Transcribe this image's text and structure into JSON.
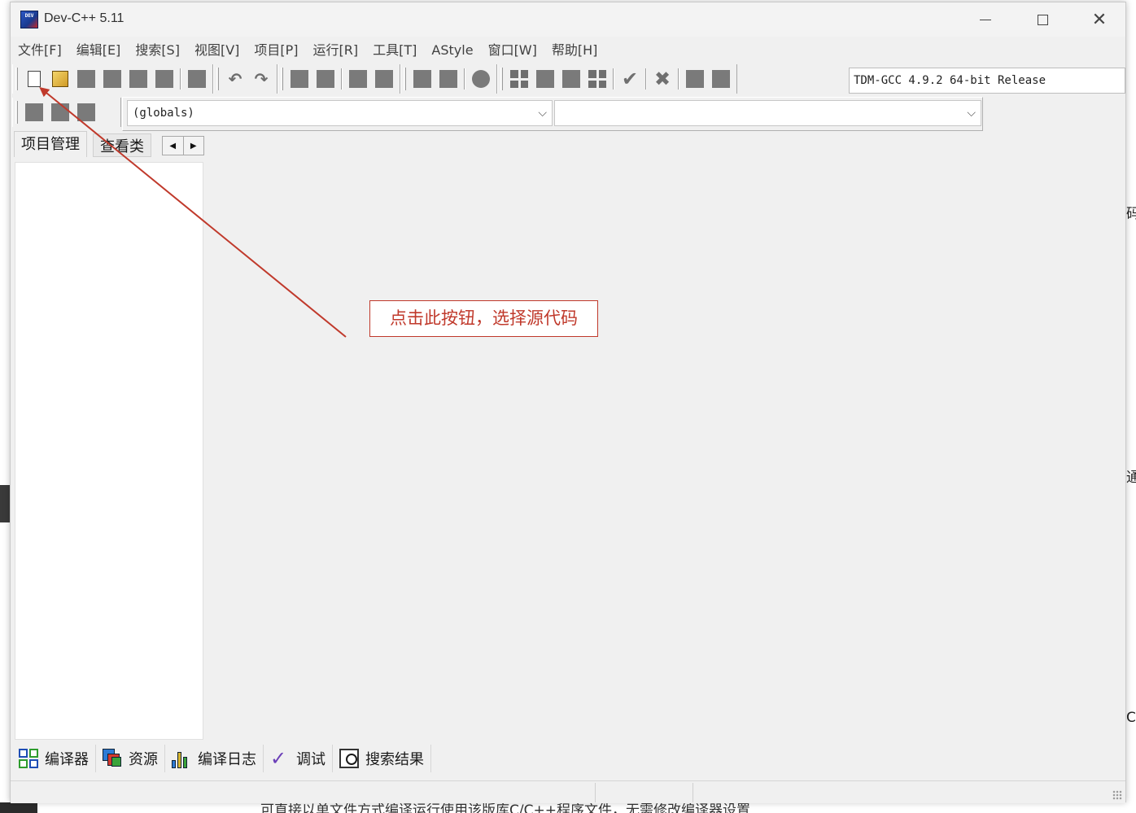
{
  "window": {
    "title": "Dev-C++ 5.11",
    "icon_label": "DEV"
  },
  "menu": [
    {
      "label": "文件[F]"
    },
    {
      "label": "编辑[E]"
    },
    {
      "label": "搜索[S]"
    },
    {
      "label": "视图[V]"
    },
    {
      "label": "项目[P]"
    },
    {
      "label": "运行[R]"
    },
    {
      "label": "工具[T]"
    },
    {
      "label": "AStyle"
    },
    {
      "label": "窗口[W]"
    },
    {
      "label": "帮助[H]"
    }
  ],
  "toolbar": {
    "compiler_select": "TDM-GCC 4.9.2 64-bit Release"
  },
  "navigation": {
    "scope_select": "(globals)",
    "member_select": ""
  },
  "left_panel": {
    "tabs": [
      {
        "label": "项目管理"
      },
      {
        "label": "查看类"
      }
    ]
  },
  "bottom_tabs": [
    {
      "label": "编译器",
      "icon": "compiler-icon"
    },
    {
      "label": "资源",
      "icon": "resources-icon"
    },
    {
      "label": "编译日志",
      "icon": "compile-log-icon"
    },
    {
      "label": "调试",
      "icon": "debug-icon"
    },
    {
      "label": "搜索结果",
      "icon": "search-results-icon"
    }
  ],
  "annotation": {
    "text": "点击此按钮，选择源代码",
    "color": "#c0392b"
  },
  "background": {
    "bottom_text": "可直接以单文件方式编译运行使用该版库C/C++程序文件，无需修改编译器设置",
    "right_edge_chars": [
      "码",
      "通",
      "C"
    ]
  },
  "colors": {
    "window_bg": "#f0f0f0",
    "annotation": "#c0392b"
  }
}
